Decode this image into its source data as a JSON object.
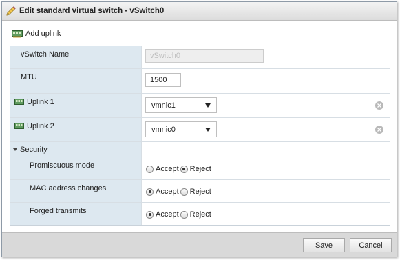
{
  "window": {
    "title": "Edit standard virtual switch - vSwitch0",
    "title_icon": "pencil-icon"
  },
  "toolbar": {
    "add_uplink_label": "Add uplink",
    "add_uplink_icon": "network-card-icon"
  },
  "form": {
    "vswitch_name": {
      "label": "vSwitch Name",
      "value": "vSwitch0"
    },
    "mtu": {
      "label": "MTU",
      "value": "1500"
    },
    "uplinks": [
      {
        "label": "Uplink 1",
        "value": "vmnic1"
      },
      {
        "label": "Uplink 2",
        "value": "vmnic0"
      }
    ],
    "security": {
      "label": "Security",
      "accept_label": "Accept",
      "reject_label": "Reject",
      "items": [
        {
          "label": "Promiscuous mode",
          "selected": "Reject"
        },
        {
          "label": "MAC address changes",
          "selected": "Accept"
        },
        {
          "label": "Forged transmits",
          "selected": "Accept"
        }
      ]
    }
  },
  "footer": {
    "save_label": "Save",
    "cancel_label": "Cancel"
  },
  "colors": {
    "label_bg": "#dde8f0",
    "footer_bg": "#d9d9d9",
    "remove_icon": "#b9b9b9"
  }
}
